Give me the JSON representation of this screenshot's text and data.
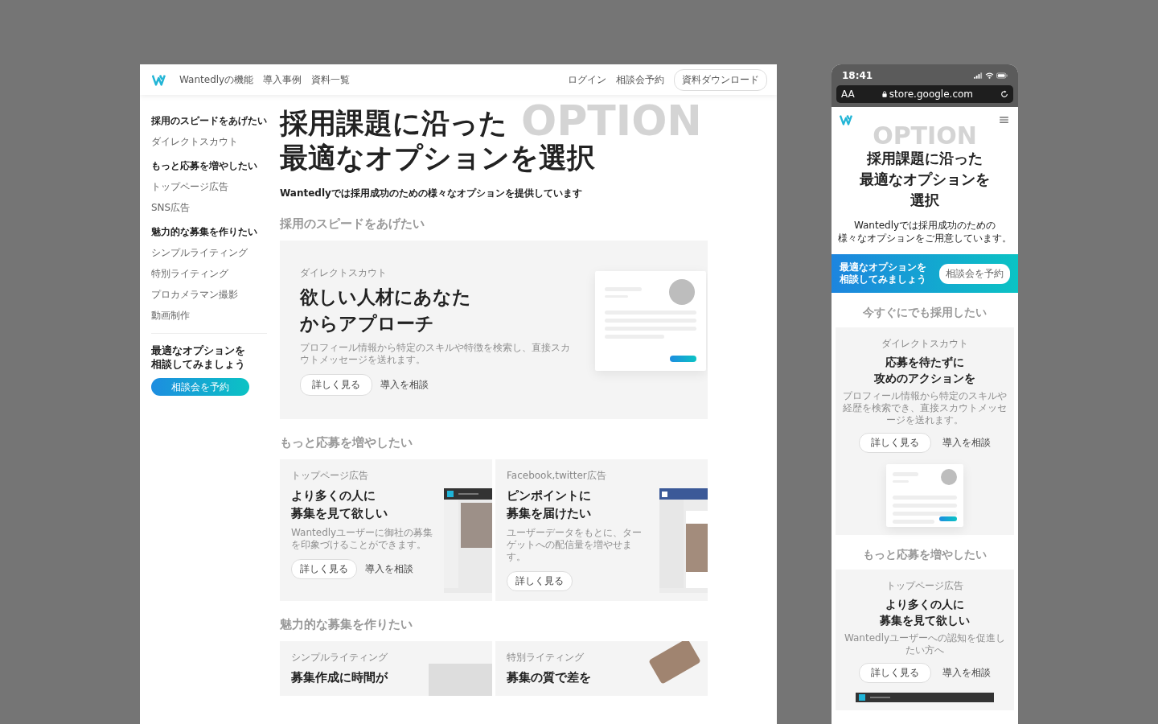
{
  "desktop": {
    "header": {
      "nav": [
        "Wantedlyの機能",
        "導入事例",
        "資料一覧"
      ],
      "links": [
        "ログイン",
        "相談会予約"
      ],
      "download_button": "資料ダウンロード"
    },
    "sidebar": {
      "groups": [
        {
          "heading": "採用のスピードをあげたい",
          "items": [
            "ダイレクトスカウト"
          ]
        },
        {
          "heading": "もっと応募を増やしたい",
          "items": [
            "トップページ広告",
            "SNS広告"
          ]
        },
        {
          "heading": "魅力的な募集を作りたい",
          "items": [
            "シンプルライティング",
            "特別ライティング",
            "プロカメラマン撮影",
            "動画制作"
          ]
        }
      ],
      "cta": {
        "lines": [
          "最適なオプションを",
          "相談してみましょう"
        ],
        "button": "相談会を予約"
      }
    },
    "hero": {
      "title_lines": [
        "採用課題に沿った",
        "最適なオプションを選択"
      ],
      "background_word": "OPTION",
      "subtitle": "Wantedlyでは採用成功のための様々なオプションを提供しています"
    },
    "sections": [
      {
        "heading": "採用のスピードをあげたい",
        "cards": [
          {
            "kind": "scout",
            "label": "ダイレクトスカウト",
            "title_lines": [
              "欲しい人材にあなた",
              "からアプローチ"
            ],
            "description": "プロフィール情報から特定のスキルや特徴を検索し、直接スカウトメッセージを送れます。",
            "buttons": [
              {
                "kind": "outline",
                "label": "詳しく見る"
              },
              {
                "kind": "text",
                "label": "導入を相談"
              }
            ]
          }
        ]
      },
      {
        "heading": "もっと応募を増やしたい",
        "cards": [
          {
            "kind": "topad",
            "label": "トップページ広告",
            "title_lines": [
              "より多くの人に",
              "募集を見て欲しい"
            ],
            "description": "Wantedlyユーザーに御社の募集を印象づけることができます。",
            "buttons": [
              {
                "kind": "outline",
                "label": "詳しく見る"
              },
              {
                "kind": "text",
                "label": "導入を相談"
              }
            ]
          },
          {
            "kind": "social",
            "label": "Facebook,twitter広告",
            "title_lines": [
              "ピンポイントに",
              "募集を届けたい"
            ],
            "description": "ユーザーデータをもとに、ターゲットへの配信量を増やせます。",
            "buttons": [
              {
                "kind": "outline",
                "label": "詳しく見る"
              }
            ]
          }
        ]
      },
      {
        "heading": "魅力的な募集を作りたい",
        "cards": [
          {
            "kind": "writing",
            "label": "シンプルライティング",
            "title_lines": [
              "募集作成に時間が"
            ]
          },
          {
            "kind": "photo",
            "label": "特別ライティング",
            "title_lines": [
              "募集の質で差を"
            ]
          }
        ]
      }
    ]
  },
  "mobile": {
    "status": {
      "time": "18:41",
      "aa": "AA",
      "url": "store.google.com"
    },
    "hero": {
      "title_lines": [
        "採用課題に沿った",
        "最適なオプションを",
        "選択"
      ],
      "background_word": "OPTION",
      "subtitle_lines": [
        "Wantedlyでは採用成功のための",
        "様々なオプションをご用意しています。"
      ]
    },
    "banner": {
      "lines": [
        "最適なオプションを",
        "相談してみましょう"
      ],
      "button": "相談会を予約"
    },
    "sections": [
      {
        "heading": "今すぐにでも採用したい",
        "card": {
          "kind": "scout",
          "label": "ダイレクトスカウト",
          "title_lines": [
            "応募を待たずに",
            "攻めのアクションを"
          ],
          "description": "プロフィール情報から特定のスキルや経歴を検索でき、直接スカウトメッセージを送れます。",
          "buttons": [
            {
              "kind": "outline",
              "label": "詳しく見る"
            },
            {
              "kind": "text",
              "label": "導入を相談"
            }
          ]
        }
      },
      {
        "heading": "もっと応募を増やしたい",
        "card": {
          "kind": "topad",
          "label": "トップページ広告",
          "title_lines": [
            "より多くの人に",
            "募集を見て欲しい"
          ],
          "description": "Wantedlyユーザーへの認知を促進したい方へ",
          "buttons": [
            {
              "kind": "outline",
              "label": "詳しく見る"
            },
            {
              "kind": "text",
              "label": "導入を相談"
            }
          ]
        }
      }
    ]
  }
}
